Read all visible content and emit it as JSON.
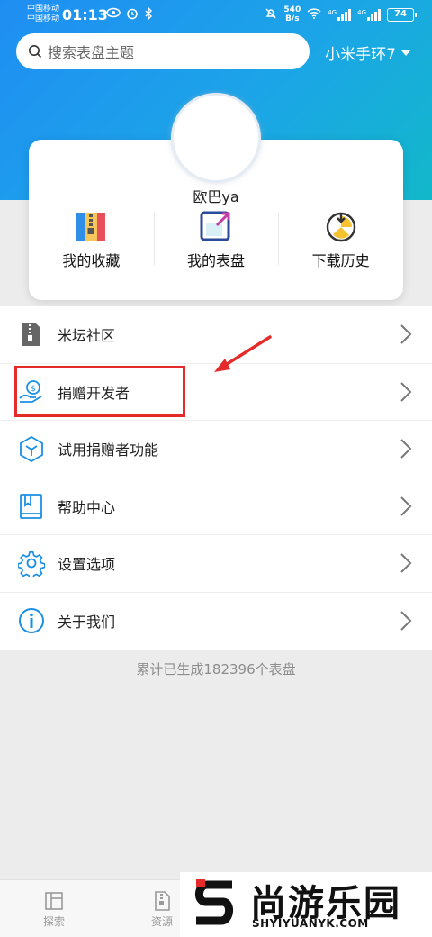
{
  "status_bar": {
    "carrier_1": "中国移动",
    "carrier_2": "中国移动",
    "time": "01:13",
    "net_speed_value": "540",
    "net_speed_unit": "B/s",
    "signal_1_label": "4G",
    "signal_2_label": "4G",
    "battery": "74"
  },
  "search": {
    "placeholder": "搜索表盘主题"
  },
  "device": {
    "name": "小米手环7"
  },
  "profile": {
    "username": "欧巴ya",
    "actions": [
      {
        "label": "我的收藏",
        "icon": "archive-icon"
      },
      {
        "label": "我的表盘",
        "icon": "watchface-icon"
      },
      {
        "label": "下载历史",
        "icon": "history-icon"
      }
    ]
  },
  "menu": [
    {
      "label": "米坛社区",
      "icon": "zip-icon"
    },
    {
      "label": "捐赠开发者",
      "icon": "donate-icon"
    },
    {
      "label": "试用捐赠者功能",
      "icon": "cube-icon"
    },
    {
      "label": "帮助中心",
      "icon": "book-icon"
    },
    {
      "label": "设置选项",
      "icon": "gear-icon"
    },
    {
      "label": "关于我们",
      "icon": "info-icon"
    }
  ],
  "stats": {
    "text": "累计已生成182396个表盘"
  },
  "bottom_nav": [
    {
      "label": "探索",
      "icon": "explore-icon"
    },
    {
      "label": "资源",
      "icon": "resource-icon"
    }
  ],
  "watermark": {
    "title": "尚游乐园",
    "subtitle": "SHYIYUANYK.COM"
  },
  "colors": {
    "accent": "#1f8ef3",
    "highlight": "#e42a2a",
    "icon_blue": "#1a8fe3"
  }
}
